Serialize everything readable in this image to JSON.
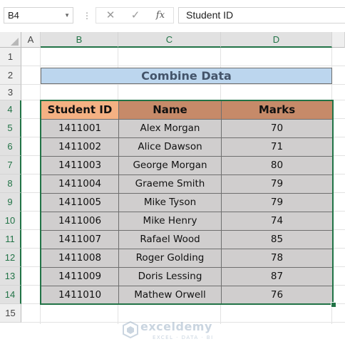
{
  "formula_bar": {
    "name_box": "B4",
    "formula": "Student ID",
    "cancel_icon": "✕",
    "enter_icon": "✓",
    "function_label": "fx"
  },
  "columns": [
    "A",
    "B",
    "C",
    "D"
  ],
  "rows": [
    "1",
    "2",
    "3",
    "4",
    "5",
    "6",
    "7",
    "8",
    "9",
    "10",
    "11",
    "12",
    "13",
    "14",
    "15"
  ],
  "sheet": {
    "title": "Combine Data",
    "headers": [
      "Student ID",
      "Name",
      "Marks"
    ],
    "records": [
      [
        "1411001",
        "Alex Morgan",
        "70"
      ],
      [
        "1411002",
        "Alice Dawson",
        "71"
      ],
      [
        "1411003",
        "George Morgan",
        "80"
      ],
      [
        "1411004",
        "Graeme Smith",
        "79"
      ],
      [
        "1411005",
        "Mike Tyson",
        "79"
      ],
      [
        "1411006",
        "Mike Henry",
        "74"
      ],
      [
        "1411007",
        "Rafael Wood",
        "85"
      ],
      [
        "1411008",
        "Roger Golding",
        "78"
      ],
      [
        "1411009",
        "Doris Lessing",
        "87"
      ],
      [
        "1411010",
        "Mathew Orwell",
        "76"
      ]
    ]
  },
  "watermark": {
    "name": "exceldemy",
    "tagline": "EXCEL · DATA · BI"
  },
  "colors": {
    "title_fill": "#bcd6ee",
    "header_fill": "#c68a69",
    "active_header_fill": "#f4b183",
    "body_fill": "#d0cece",
    "selection": "#217346"
  },
  "selection": {
    "active_cell": "B4",
    "range": "B4:D14"
  }
}
